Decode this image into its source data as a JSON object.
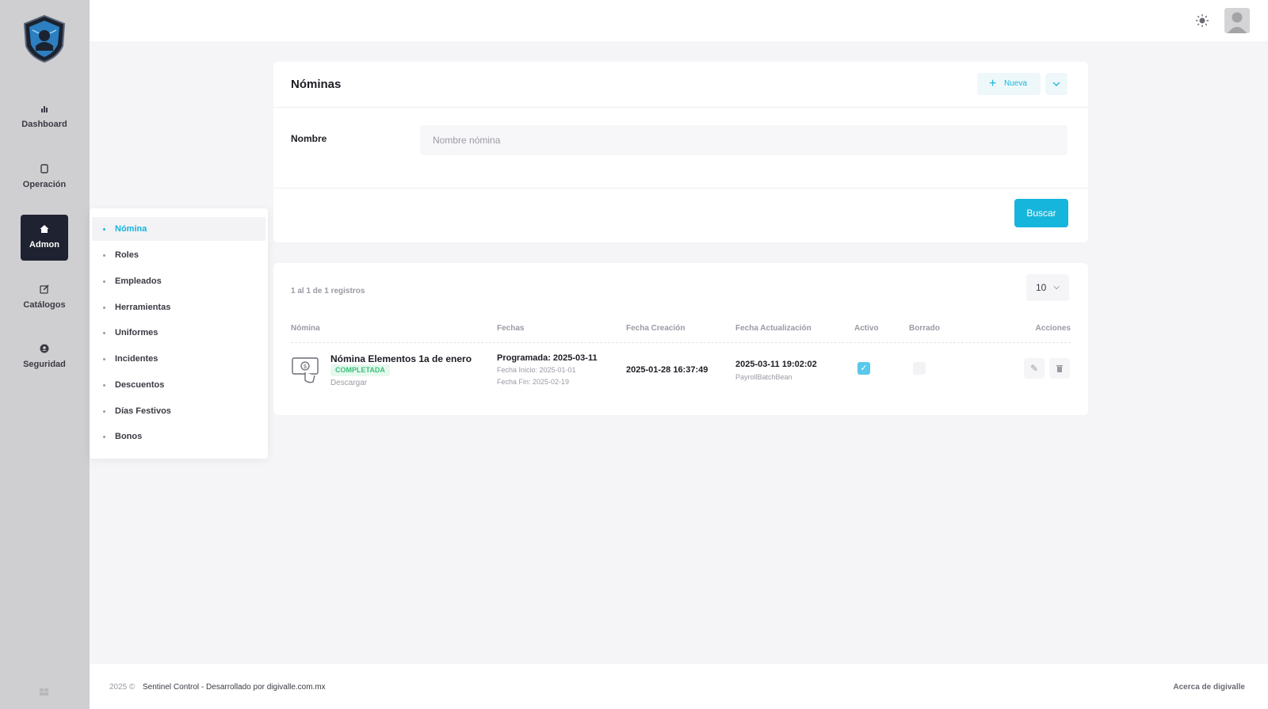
{
  "sidebar": {
    "items": [
      {
        "label": "Dashboard",
        "icon": "bar-chart-icon"
      },
      {
        "label": "Operación",
        "icon": "copy-icon"
      },
      {
        "label": "Admon",
        "icon": "home-icon"
      },
      {
        "label": "Catálogos",
        "icon": "edit-icon"
      },
      {
        "label": "Seguridad",
        "icon": "user-shield-icon"
      }
    ]
  },
  "submenu": {
    "items": [
      {
        "label": "Nómina"
      },
      {
        "label": "Roles"
      },
      {
        "label": "Empleados"
      },
      {
        "label": "Herramientas"
      },
      {
        "label": "Uniformes"
      },
      {
        "label": "Incidentes"
      },
      {
        "label": "Descuentos"
      },
      {
        "label": "Días Festivos"
      },
      {
        "label": "Bonos"
      }
    ]
  },
  "search_card": {
    "title": "Nóminas",
    "new_label": "Nueva",
    "field_label": "Nombre",
    "field_placeholder": "Nombre nómina",
    "search_label": "Buscar"
  },
  "results": {
    "count_text": "1 al 1 de 1 registros",
    "page_size": "10",
    "columns": [
      "Nómina",
      "Fechas",
      "Fecha Creación",
      "Fecha Actualización",
      "Activo",
      "Borrado",
      "Acciones"
    ],
    "rows": [
      {
        "nombre": "Nómina Elementos 1a de enero",
        "estado": "COMPLETADA",
        "descargar": "Descargar",
        "programada": "Programada: 2025-03-11",
        "fecha_inicio": "Fecha Inicio: 2025-01-01",
        "fecha_fin": "Fecha Fin: 2025-02-19",
        "fecha_creacion": "2025-01-28 16:37:49",
        "fecha_actualizacion": "2025-03-11 19:02:02",
        "actualizado_por": "PayrollBatchBean",
        "activo": true,
        "borrado": false
      }
    ]
  },
  "footer": {
    "year": "2025 ©",
    "text": "Sentinel Control - Desarrollado por digivalle.com.mx",
    "link": "Acerca de digivalle"
  },
  "colors": {
    "accent": "#16b5dc",
    "sidebar_bg": "#cfcfd1",
    "active_nav": "#1f2230",
    "badge_green": "#3ac177"
  }
}
